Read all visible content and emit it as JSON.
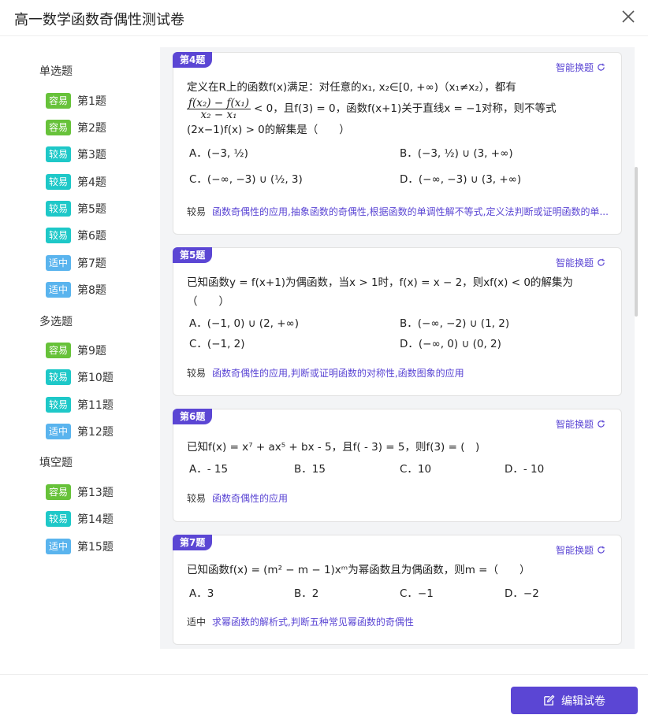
{
  "header": {
    "title": "高一数学函数奇偶性测试卷"
  },
  "colors": {
    "easy": "#67c23a",
    "medium_easy": "#1ec8c8",
    "medium": "#5ab4ee",
    "accent": "#5b46d4"
  },
  "sidebar": {
    "sections": [
      {
        "title": "单选题"
      },
      {
        "title": "多选题"
      },
      {
        "title": "填空题"
      }
    ],
    "items": [
      {
        "badge": "容易",
        "label": "第1题"
      },
      {
        "badge": "容易",
        "label": "第2题"
      },
      {
        "badge": "较易",
        "label": "第3题"
      },
      {
        "badge": "较易",
        "label": "第4题"
      },
      {
        "badge": "较易",
        "label": "第5题"
      },
      {
        "badge": "较易",
        "label": "第6题"
      },
      {
        "badge": "适中",
        "label": "第7题"
      },
      {
        "badge": "适中",
        "label": "第8题"
      },
      {
        "badge": "容易",
        "label": "第9题"
      },
      {
        "badge": "较易",
        "label": "第10题"
      },
      {
        "badge": "较易",
        "label": "第11题"
      },
      {
        "badge": "适中",
        "label": "第12题"
      },
      {
        "badge": "容易",
        "label": "第13题"
      },
      {
        "badge": "较易",
        "label": "第14题"
      },
      {
        "badge": "适中",
        "label": "第15题"
      }
    ]
  },
  "swap_label": "智能换题",
  "questions": [
    {
      "no": "第4题",
      "stem_l1": "定义在R上的函数f(x)满足：对任意的x₁, x₂∈[0, +∞)（x₁≠x₂），都有",
      "stem_l2_tail": "< 0，且f(3) = 0，函数f(x+1)关于直线x = −1对称，则不等式",
      "stem_l3": "(2x−1)f(x) > 0的解集是（　　）",
      "frac_num": "f(x₂) − f(x₁)",
      "frac_den": "x₂ − x₁",
      "options": [
        "A．(−3, ½)",
        "B．(−3, ½) ∪ (3, +∞)",
        "C．(−∞, −3) ∪ (½, 3)",
        "D．(−∞, −3) ∪ (3, +∞)"
      ],
      "level": "较易",
      "tags": "函数奇偶性的应用,抽象函数的奇偶性,根据函数的单调性解不等式,定义法判断或证明函数的单..."
    },
    {
      "no": "第5题",
      "stem_l1": "已知函数y = f(x+1)为偶函数，当x > 1时，f(x) = x − 2，则xf(x) < 0的解集为",
      "stem_l2": "（　　）",
      "options": [
        "A．(−1, 0) ∪ (2, +∞)",
        "B．(−∞, −2) ∪ (1, 2)",
        "C．(−1, 2)",
        "D．(−∞, 0) ∪ (0, 2)"
      ],
      "level": "较易",
      "tags": "函数奇偶性的应用,判断或证明函数的对称性,函数图象的应用"
    },
    {
      "no": "第6题",
      "stem_l1": "已知f(x) = x⁷ + ax⁵ + bx - 5，且f( - 3) = 5，则f(3) = (　)",
      "options": [
        "A．- 15",
        "B．15",
        "C．10",
        "D．- 10"
      ],
      "level": "较易",
      "tags": "函数奇偶性的应用"
    },
    {
      "no": "第7题",
      "stem_l1": "已知函数f(x) = (m² − m − 1)xᵐ为幂函数且为偶函数，则m =（　　）",
      "options": [
        "A．3",
        "B．2",
        "C．−1",
        "D．−2"
      ],
      "level": "适中",
      "tags": "求幂函数的解析式,判断五种常见幂函数的奇偶性"
    }
  ],
  "footer": {
    "edit_label": "编辑试卷"
  }
}
